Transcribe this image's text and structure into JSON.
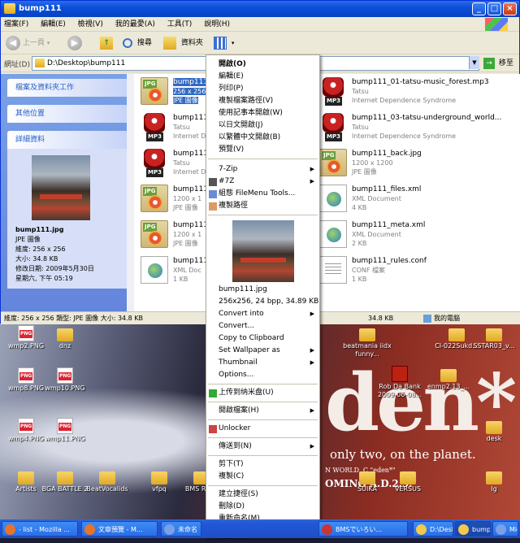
{
  "window": {
    "title": "bump111",
    "menu": [
      "檔案(F)",
      "編輯(E)",
      "檢視(V)",
      "我的最愛(A)",
      "工具(T)",
      "說明(H)"
    ],
    "toolbar": {
      "back": "上一頁",
      "search": "搜尋",
      "folders": "資料夾"
    },
    "address": {
      "label": "網址(D)",
      "value": "D:\\Desktop\\bump111",
      "go": "移至"
    }
  },
  "taskpane": {
    "file_tasks": "檔案及資料夾工作",
    "other_places": "其他位置",
    "details": {
      "header": "詳細資料",
      "name": "bump111.jpg",
      "type": "JPE 圖像",
      "dimensions": "維度: 256 x 256",
      "size": "大小: 34.8 KB",
      "modified": "修改日期: 2009年5月30日",
      "modified_time": "星期六, 下午 05:19"
    }
  },
  "files_left": [
    {
      "icon": "jpg",
      "name": "bump111",
      "l2": "256 x 256",
      "l3": "JPE 圖像",
      "selected": true
    },
    {
      "icon": "mp3",
      "name": "bump111",
      "l2": "Tatsu",
      "l3": "Internet D"
    },
    {
      "icon": "mp3",
      "name": "bump111",
      "l2": "Tatsu",
      "l3": "Internet D"
    },
    {
      "icon": "jpg",
      "name": "bump111",
      "l2": "1200 x 1",
      "l3": "JPE 圖像"
    },
    {
      "icon": "jpg",
      "name": "bump111",
      "l2": "1200 x 1",
      "l3": "JPE 圖像"
    },
    {
      "icon": "xml",
      "name": "bump111",
      "l2": "XML Doc",
      "l3": "1 KB"
    }
  ],
  "files_right": [
    {
      "icon": "mp3",
      "name": "bump111_01-tatsu-music_forest.mp3",
      "l2": "Tatsu",
      "l3": "Internet Dependence Syndrome"
    },
    {
      "icon": "mp3",
      "name": "bump111_03-tatsu-underground_world...",
      "l2": "Tatsu",
      "l3": "Internet Dependence Syndrome"
    },
    {
      "icon": "jpg",
      "name": "bump111_back.jpg",
      "l2": "1200 x 1200",
      "l3": "JPE 圖像"
    },
    {
      "icon": "xml",
      "name": "bump111_files.xml",
      "l2": "XML Document",
      "l3": "4 KB"
    },
    {
      "icon": "xml",
      "name": "bump111_meta.xml",
      "l2": "XML Document",
      "l3": "2 KB"
    },
    {
      "icon": "conf",
      "name": "bump111_rules.conf",
      "l2": "CONF 檔案",
      "l3": "1 KB"
    }
  ],
  "statusbar": {
    "info": "維度: 256 x 256 類型: JPE 圖像 大小: 34.8 KB",
    "size": "34.8 KB",
    "zone": "我的電腦"
  },
  "context_menu": {
    "group1": [
      "開啟(O)",
      "編輯(E)",
      "列印(P)",
      "複製檔案路徑(V)",
      "使用記事本開啟(W)",
      "以日文開啟(J)",
      "以繁體中文開啟(B)",
      "預覽(V)"
    ],
    "group2": [
      "7-Zip",
      "#7Z",
      "組態 FileMenu Tools...",
      "複製路徑"
    ],
    "preview": {
      "name": "bump111.jpg",
      "info": "256x256, 24 bpp, 34.89 KB"
    },
    "group3": [
      "Convert into",
      "Convert...",
      "Copy to Clipboard",
      "Set Wallpaper as",
      "Thumbnail",
      "Options..."
    ],
    "group4": [
      "上传到纳米盘(U)"
    ],
    "group5": [
      "開啟檔案(H)"
    ],
    "group6": [
      "Unlocker"
    ],
    "group7": [
      "傳送到(N)"
    ],
    "group8": [
      "剪下(T)",
      "複製(C)"
    ],
    "group9": [
      "建立捷徑(S)",
      "刪除(D)",
      "重新命名(M)"
    ],
    "group10": [
      "內容(R)"
    ]
  },
  "desktop": {
    "icons": [
      {
        "label": "wmp2.PNG",
        "kind": "png"
      },
      {
        "label": "dnz",
        "kind": "folder"
      },
      {
        "label": "wmp8.PNG",
        "kind": "png"
      },
      {
        "label": "wmp10.PNG",
        "kind": "png"
      },
      {
        "label": "wmp4.PNG",
        "kind": "png"
      },
      {
        "label": "wmp11.PNG",
        "kind": "png"
      },
      {
        "label": "Artists",
        "kind": "folder"
      },
      {
        "label": "BGA BATTLE 2",
        "kind": "folder"
      },
      {
        "label": "BeatVocalids",
        "kind": "folder"
      },
      {
        "label": "vfpq",
        "kind": "folder"
      },
      {
        "label": "BMS Regu",
        "kind": "folder"
      },
      {
        "label": "beatmania iidx funny...",
        "kind": "folder"
      },
      {
        "label": "Rob Da Bank 2009-06-08...",
        "kind": "mp3"
      },
      {
        "label": "enmp2.13_...",
        "kind": "folder"
      },
      {
        "label": "CI-022Sukd...",
        "kind": "folder"
      },
      {
        "label": "SSTAR03_v...",
        "kind": "folder"
      },
      {
        "label": "desk",
        "kind": "folder"
      },
      {
        "label": "SUIKA",
        "kind": "folder"
      },
      {
        "label": "VERSUS",
        "kind": "folder"
      },
      {
        "label": "lg",
        "kind": "folder"
      }
    ],
    "wallpaper": {
      "big": "den*",
      "sub": "only two, on the planet.",
      "line2": "N WORLD, C    \"eden*\"",
      "line3": "OMING A.D.2.9."
    }
  },
  "taskbar": [
    {
      "label": "- list - Mozilla ...",
      "color": "#e8742a"
    },
    {
      "label": "文章預覽 - M...",
      "color": "#e8742a"
    },
    {
      "label": "未命名",
      "color": "#7aa0e8"
    },
    {
      "label": "BMSでいろい...",
      "color": "#c33"
    },
    {
      "label": "D:\\Desktop\\d...",
      "color": "#f2c94c"
    },
    {
      "label": "bump111",
      "color": "#f2c94c",
      "active": true
    },
    {
      "label": "Mic",
      "color": "#7aa0e8"
    }
  ]
}
